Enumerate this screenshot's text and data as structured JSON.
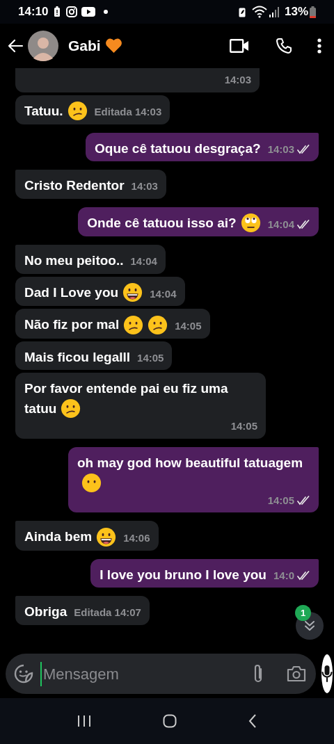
{
  "status_bar": {
    "time": "14:10",
    "battery": "13%"
  },
  "header": {
    "contact_name": "Gabi"
  },
  "messages": [
    {
      "kind": "incoming",
      "cut": true,
      "time": "14:03"
    },
    {
      "kind": "incoming",
      "text": "Tatuu.",
      "emoji": [
        {
          "kind": "confused"
        }
      ],
      "time": "Editada 14:03"
    },
    {
      "kind": "outgoing",
      "text": "Oque cê tatuou desgraça?",
      "time": "14:03",
      "read": true
    },
    {
      "kind": "incoming",
      "text": "Cristo Redentor",
      "time": "14:03"
    },
    {
      "kind": "outgoing",
      "text": "Onde cê tatuou isso ai?",
      "emoji": [
        {
          "kind": "eye-roll"
        }
      ],
      "time": "14:04",
      "read": true
    },
    {
      "kind": "incoming",
      "text": "No meu peitoo..",
      "time": "14:04"
    },
    {
      "kind": "incoming",
      "text": "Dad I Love you",
      "emoji": [
        {
          "kind": "grin"
        }
      ],
      "time": "14:04"
    },
    {
      "kind": "incoming",
      "text": "Não fiz por mal",
      "emoji": [
        {
          "kind": "confused"
        },
        {
          "kind": "confused"
        }
      ],
      "time": "14:05"
    },
    {
      "kind": "incoming",
      "text": "Mais ficou legalll",
      "time": "14:05"
    },
    {
      "kind": "incoming",
      "text": "Por favor entende pai eu fiz uma tatuu",
      "emoji": [
        {
          "kind": "confused"
        }
      ],
      "time": "14:05"
    },
    {
      "kind": "outgoing",
      "text": "oh may god how beautiful tatuagem",
      "emoji": [
        {
          "kind": "no-mouth"
        }
      ],
      "time": "14:05",
      "read": true
    },
    {
      "kind": "incoming",
      "text": "Ainda bem",
      "emoji": [
        {
          "kind": "grin"
        }
      ],
      "time": "14:06"
    },
    {
      "kind": "outgoing",
      "text": "I love you bruno I love you",
      "time": "14:0",
      "read": true
    },
    {
      "kind": "incoming",
      "text": "Obriga",
      "time": "Editada 14:07"
    }
  ],
  "unread_badge": "1",
  "composer": {
    "placeholder": "Mensagem"
  }
}
